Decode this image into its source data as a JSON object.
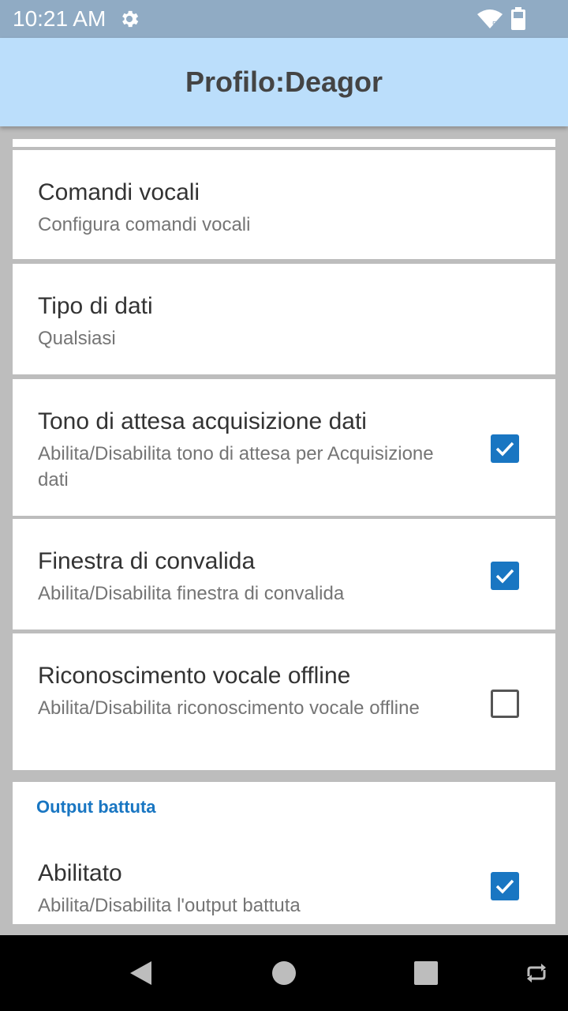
{
  "status_bar": {
    "time": "10:21 AM",
    "icons": [
      "gear-icon",
      "wifi-icon",
      "battery-icon"
    ]
  },
  "app_bar": {
    "title": "Profilo:Deagor"
  },
  "settings": [
    {
      "title": "Comandi vocali",
      "summary": "Configura comandi vocali"
    },
    {
      "title": "Tipo di dati",
      "summary": "Qualsiasi"
    },
    {
      "title": "Tono di attesa acquisizione dati",
      "summary": "Abilita/Disabilita tono di attesa per Acquisizione dati",
      "checked": true
    },
    {
      "title": "Finestra di convalida",
      "summary": "Abilita/Disabilita finestra di convalida",
      "checked": true
    },
    {
      "title": "Riconoscimento vocale offline",
      "summary": "Abilita/Disabilita riconoscimento vocale offline",
      "checked": false
    }
  ],
  "output_section": {
    "header": "Output battuta",
    "items": [
      {
        "title": "Abilitato",
        "summary": "Abilita/Disabilita l'output battuta",
        "checked": true
      }
    ]
  },
  "nav_bar": {
    "buttons": [
      "back-icon",
      "home-icon",
      "recents-icon",
      "rotate-icon"
    ]
  },
  "colors": {
    "status_bar": "#90abc4",
    "app_bar": "#bbdefb",
    "accent": "#1976c2",
    "background": "#bdbdbd"
  }
}
